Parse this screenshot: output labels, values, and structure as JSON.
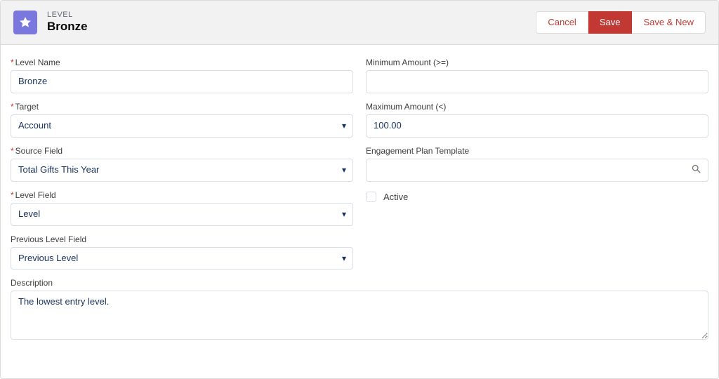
{
  "header": {
    "eyebrow": "LEVEL",
    "title": "Bronze",
    "actions": {
      "cancel": "Cancel",
      "save": "Save",
      "save_new": "Save & New"
    }
  },
  "left": {
    "level_name": {
      "label": "Level Name",
      "value": "Bronze",
      "required": true
    },
    "target": {
      "label": "Target",
      "value": "Account",
      "required": true,
      "options": [
        "Account"
      ]
    },
    "source_field": {
      "label": "Source Field",
      "value": "Total Gifts This Year",
      "required": true,
      "options": [
        "Total Gifts This Year"
      ]
    },
    "level_field": {
      "label": "Level Field",
      "value": "Level",
      "required": true,
      "options": [
        "Level"
      ]
    },
    "previous_level_field": {
      "label": "Previous Level Field",
      "value": "Previous Level",
      "required": false,
      "options": [
        "Previous Level"
      ]
    },
    "description": {
      "label": "Description",
      "value": "The lowest entry level.",
      "required": false
    }
  },
  "right": {
    "min_amount": {
      "label": "Minimum Amount (>=)",
      "value": "",
      "required": false
    },
    "max_amount": {
      "label": "Maximum Amount (<)",
      "value": "100.00",
      "required": false
    },
    "engagement_plan_template": {
      "label": "Engagement Plan Template",
      "value": "",
      "required": false
    },
    "active": {
      "label": "Active",
      "checked": false
    }
  }
}
